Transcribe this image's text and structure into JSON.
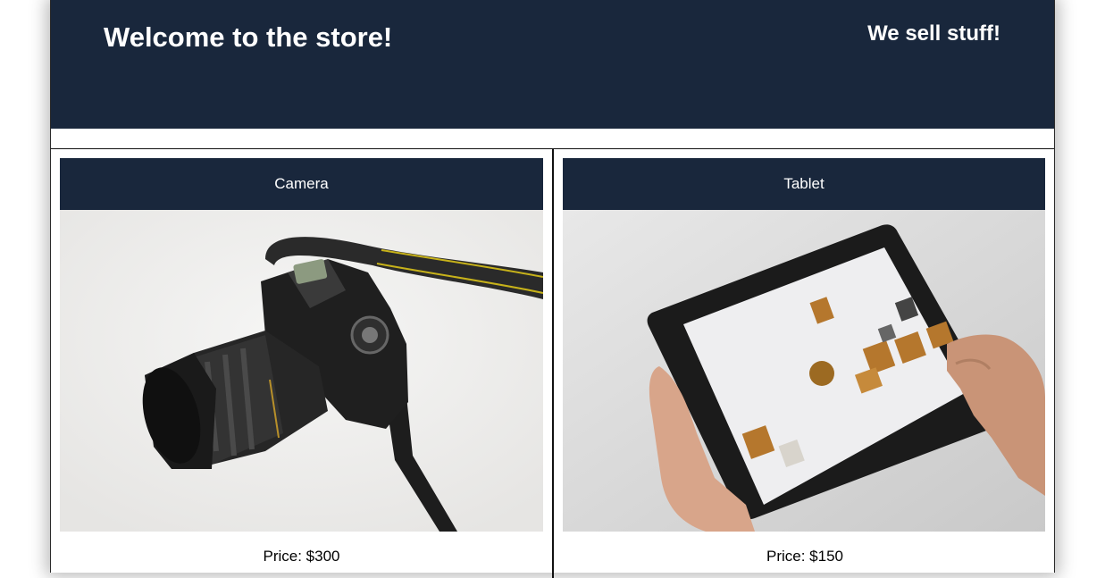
{
  "header": {
    "title": "Welcome to the store!",
    "tagline": "We sell stuff!"
  },
  "products": [
    {
      "name": "Camera",
      "price": "Price: $300",
      "image_icon": "camera-photo"
    },
    {
      "name": "Tablet",
      "price": "Price: $150",
      "image_icon": "tablet-photo"
    }
  ],
  "colors": {
    "header_bg": "#19273c",
    "header_text": "#ffffff"
  }
}
